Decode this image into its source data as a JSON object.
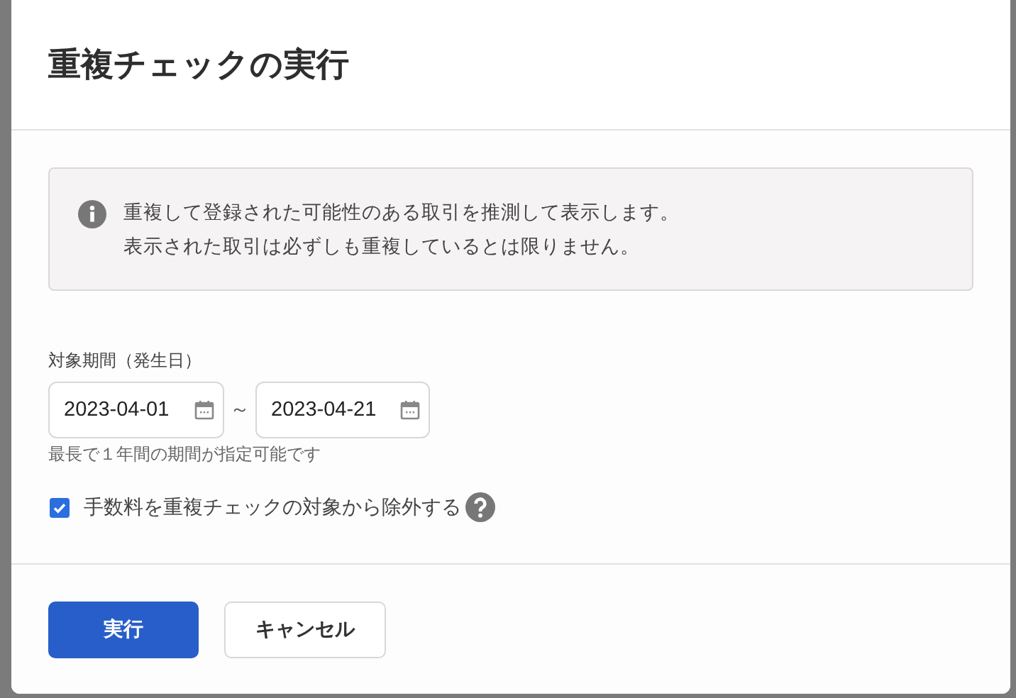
{
  "dialog": {
    "title": "重複チェックの実行",
    "notice": {
      "lines": [
        "重複して登録された可能性のある取引を推測して表示します。",
        "表示された取引は必ずしも重複しているとは限りません。"
      ]
    },
    "period": {
      "label": "対象期間（発生日）",
      "from": {
        "value": "2023-04-01"
      },
      "separator": "～",
      "to": {
        "value": "2023-04-21"
      },
      "hint": "最長で１年間の期間が指定可能です"
    },
    "option": {
      "label": "手数料を重複チェックの対象から除外する",
      "checked": true
    },
    "buttons": [
      {
        "label": "実行",
        "kind": "primary"
      },
      {
        "label": "キャンセル",
        "kind": "secondary"
      }
    ]
  }
}
